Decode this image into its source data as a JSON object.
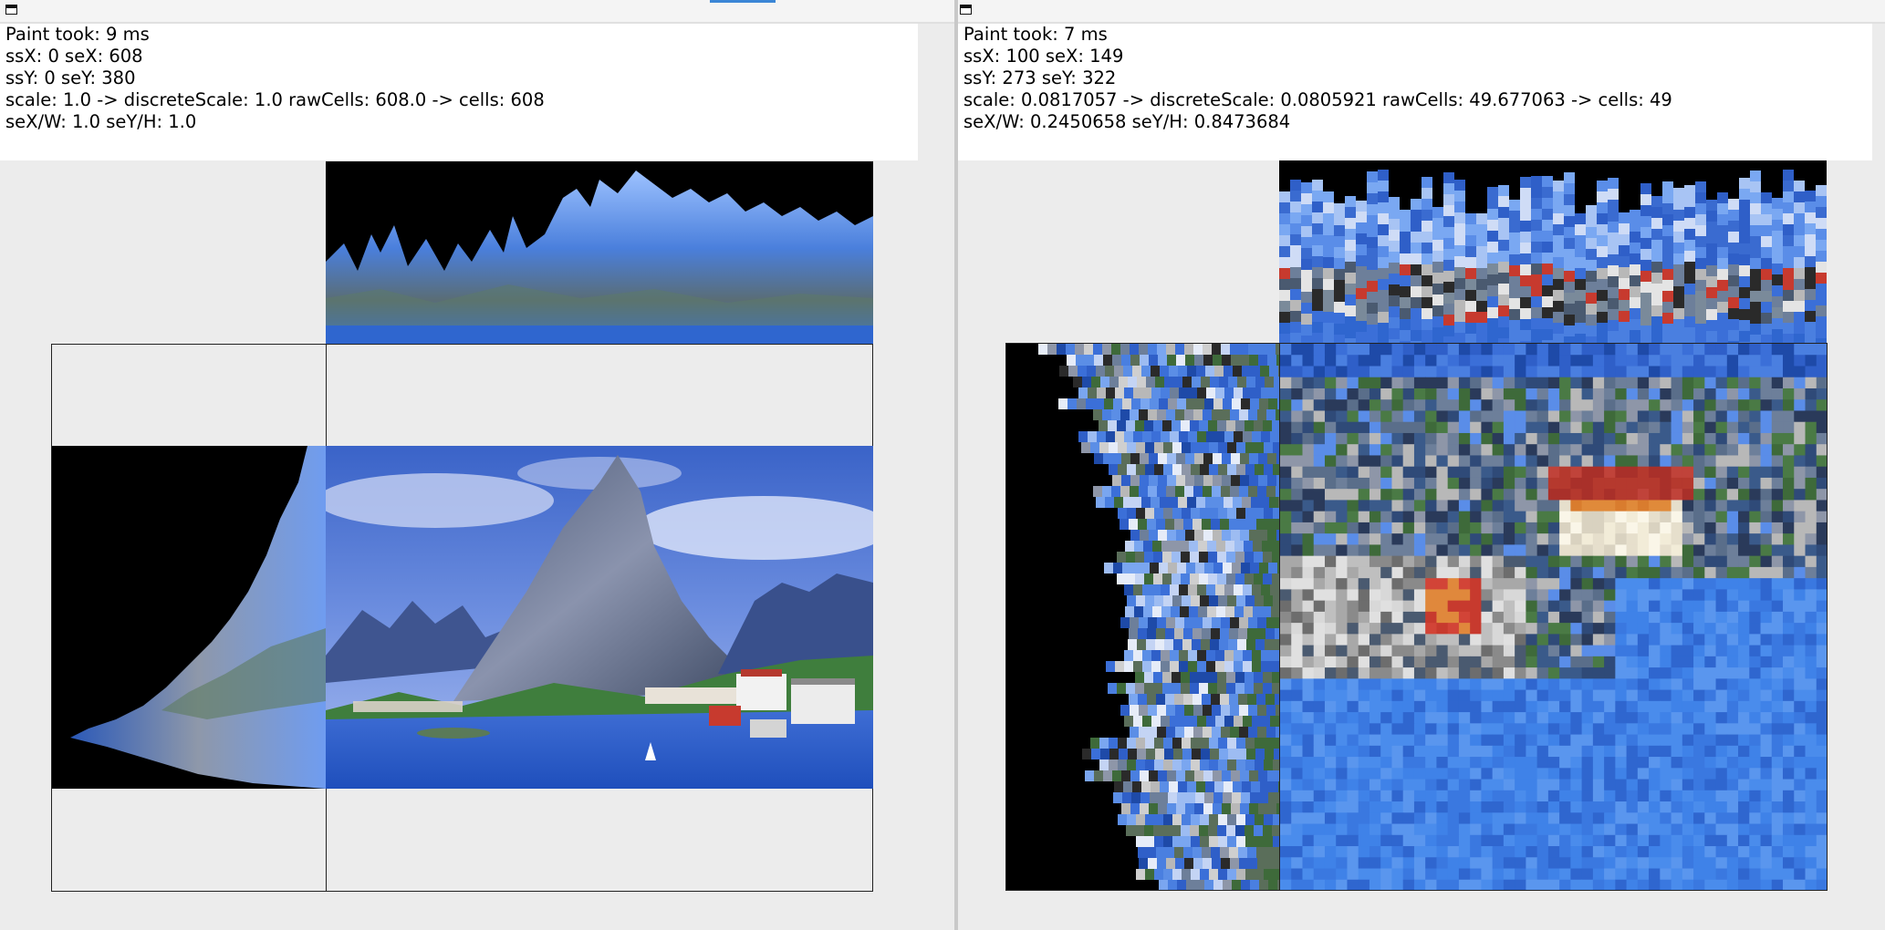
{
  "left_panel": {
    "lines": [
      "Paint took: 9 ms",
      "ssX: 0 seX: 608",
      "ssY: 0 seY: 380",
      "scale: 1.0 -> discreteScale: 1.0 rawCells: 608.0 -> cells: 608",
      "seX/W: 1.0 seY/H: 1.0"
    ]
  },
  "right_panel": {
    "lines": [
      "Paint took: 7 ms",
      "ssX: 100 seX: 149",
      "ssY: 273 seY: 322",
      "scale: 0.0817057 -> discreteScale: 0.0805921 rawCells: 49.677063 -> cells: 49",
      "seX/W: 0.2450658 seY/H: 0.8473684"
    ]
  },
  "colors": {
    "pane_background": "#ececec",
    "info_background": "#ffffff",
    "focus_accent": "#3b86d6",
    "sky_blue": "#3f6fd0",
    "black": "#000000"
  },
  "icons": [
    "window-icon"
  ]
}
